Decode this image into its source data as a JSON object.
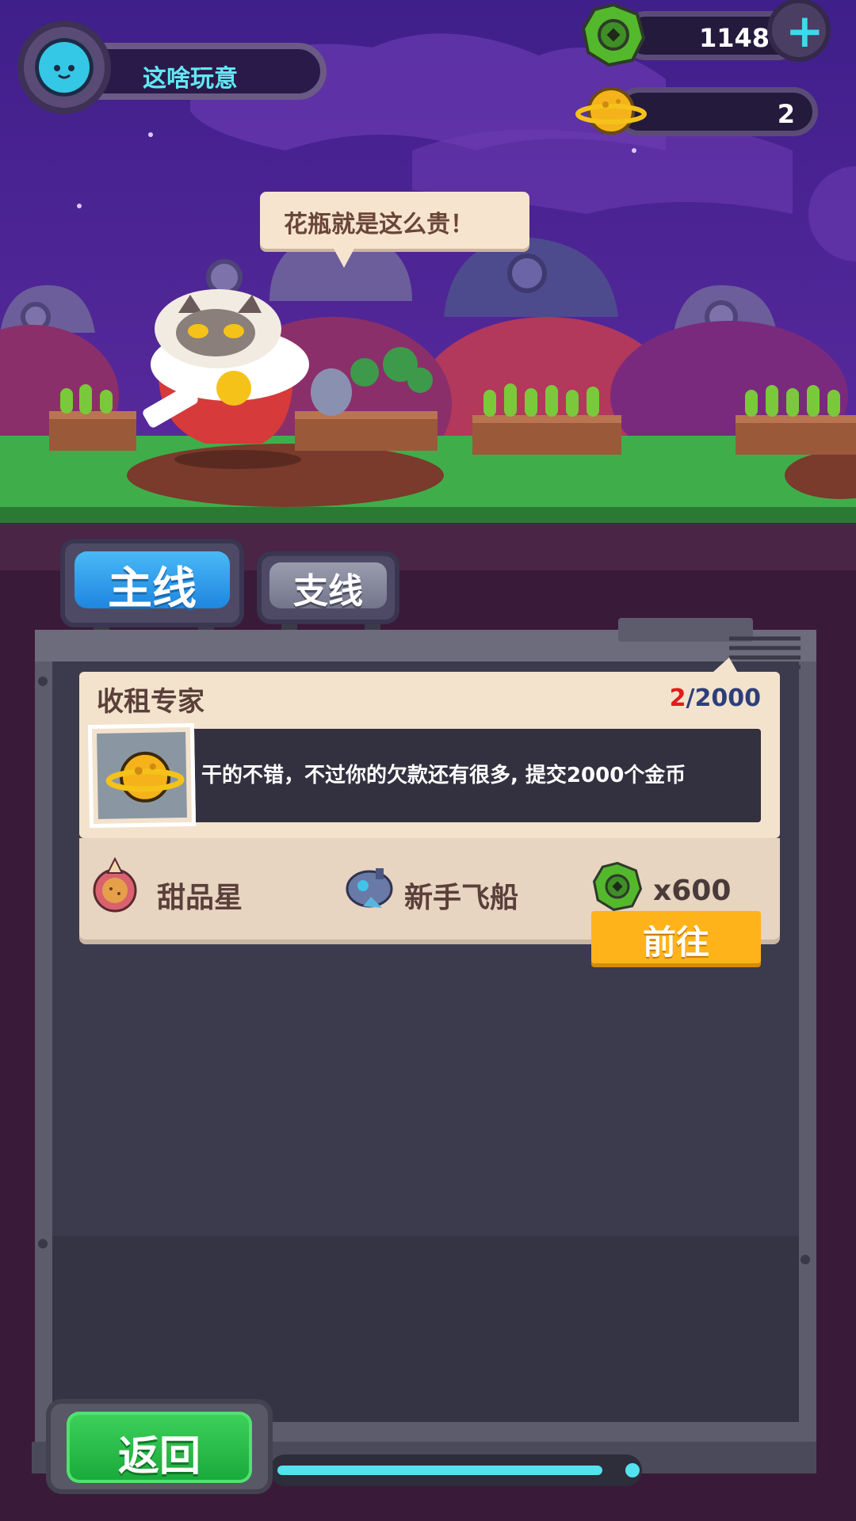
{
  "player": {
    "name": "这啥玩意"
  },
  "currencies": {
    "gems": {
      "icon": "green-gear-coin-icon",
      "value": "1148"
    },
    "coins": {
      "icon": "gold-planet-coin-icon",
      "value": "2"
    }
  },
  "npc": {
    "speech": "花瓶就是这么贵！"
  },
  "tabs": {
    "main": "主线",
    "side": "支线"
  },
  "quest": {
    "title": "收租专家",
    "progress_current": "2",
    "progress_total": "/2000",
    "description": "干的不错，不过你的欠款还有很多, 提交2000个金币",
    "icon": "gold-planet-coin-icon",
    "rewards": [
      {
        "icon": "dessert-planet-icon",
        "label": "甜品星"
      },
      {
        "icon": "starter-spaceship-icon",
        "label": "新手飞船"
      },
      {
        "icon": "green-gear-coin-icon",
        "label": "x600"
      }
    ],
    "go_label": "前往"
  },
  "footer": {
    "back_label": "返回"
  },
  "colors": {
    "accent_blue": "#2a9ae9",
    "go_orange": "#ffb31a",
    "back_green": "#22b843",
    "progress_red": "#e21b1b"
  }
}
